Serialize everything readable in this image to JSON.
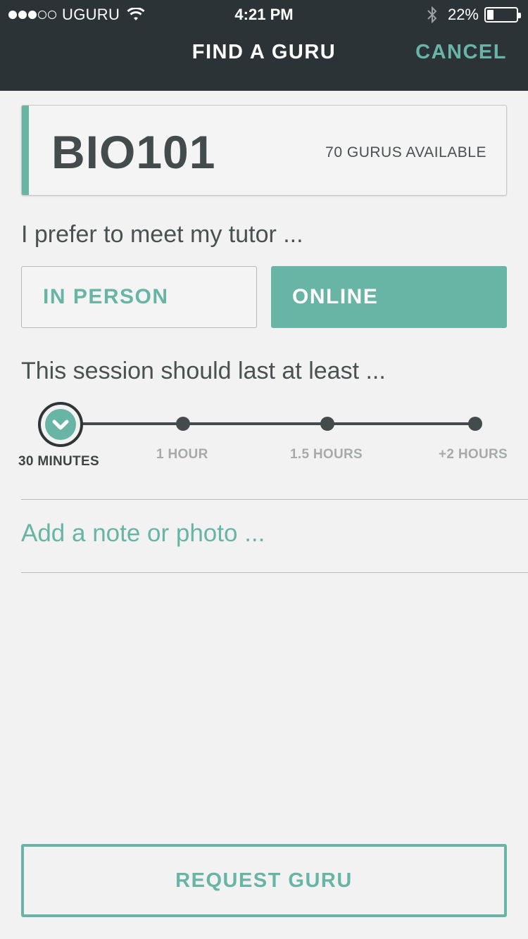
{
  "status_bar": {
    "carrier": "UGURU",
    "signal_full": 3,
    "signal_total": 5,
    "time": "4:21 PM",
    "battery_percent_label": "22%",
    "battery_level": 0.22,
    "icons": [
      "wifi-icon",
      "bluetooth-icon",
      "battery-icon"
    ]
  },
  "nav": {
    "title": "FIND A GURU",
    "cancel_label": "CANCEL"
  },
  "course": {
    "code": "BIO101",
    "available": "70 GURUS AVAILABLE"
  },
  "meet": {
    "question": "I prefer to meet my tutor ...",
    "options": [
      "IN PERSON",
      "ONLINE"
    ],
    "selected": "ONLINE"
  },
  "duration": {
    "question": "This session should last at least ...",
    "options": [
      "30 MINUTES",
      "1 HOUR",
      "1.5 HOURS",
      "+2 HOURS"
    ],
    "selected": "30 MINUTES",
    "selected_icon": "chevron-down-icon"
  },
  "note": {
    "placeholder": "Add a note or photo ..."
  },
  "actions": {
    "request_label": "REQUEST GURU"
  },
  "colors": {
    "accent": "#69b5a5",
    "header_bg": "#2b3336",
    "text_dark": "#434b4d",
    "background": "#f2f2f2"
  }
}
